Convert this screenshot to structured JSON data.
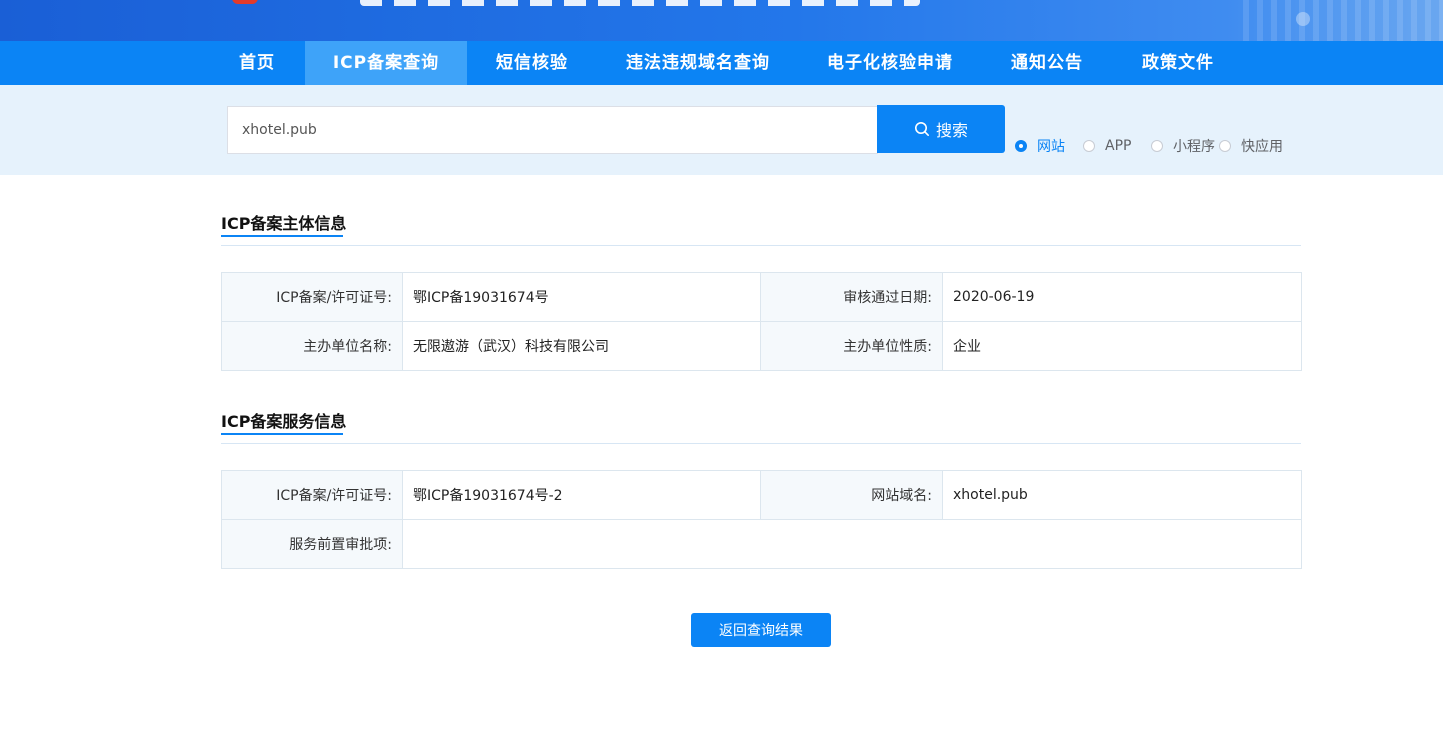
{
  "nav": {
    "items": [
      "首页",
      "ICP备案查询",
      "短信核验",
      "违法违规域名查询",
      "电子化核验申请",
      "通知公告",
      "政策文件"
    ],
    "active_index": 1
  },
  "search": {
    "value": "xhotel.pub",
    "button_label": "搜索",
    "options": [
      "网站",
      "APP",
      "小程序",
      "快应用"
    ],
    "selected_index": 0
  },
  "subject_info": {
    "title": "ICP备案主体信息",
    "rows": [
      {
        "label1": "ICP备案/许可证号:",
        "value1": "鄂ICP备19031674号",
        "label2": "审核通过日期:",
        "value2": "2020-06-19"
      },
      {
        "label1": "主办单位名称:",
        "value1": "无限遨游（武汉）科技有限公司",
        "label2": "主办单位性质:",
        "value2": "企业"
      }
    ]
  },
  "service_info": {
    "title": "ICP备案服务信息",
    "license_label": "ICP备案/许可证号:",
    "license_value": "鄂ICP备19031674号-2",
    "domain_label": "网站域名:",
    "domain_value": "xhotel.pub",
    "approval_label": "服务前置审批项:",
    "approval_value": ""
  },
  "back_button_label": "返回查询结果",
  "colors": {
    "primary": "#0b84f5",
    "nav_active": "#3ea3f9",
    "search_band": "#e6f2fc"
  }
}
